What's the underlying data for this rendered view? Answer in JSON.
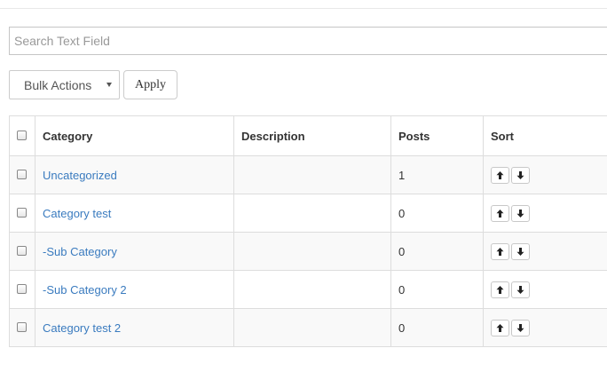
{
  "search": {
    "placeholder": "Search Text Field"
  },
  "bulk_actions": {
    "selected": "Bulk Actions"
  },
  "apply_label": "Apply",
  "table": {
    "headers": {
      "category": "Category",
      "description": "Description",
      "posts": "Posts",
      "sort": "Sort"
    },
    "rows": [
      {
        "category": "Uncategorized",
        "description": "",
        "posts": "1"
      },
      {
        "category": "Category test",
        "description": "",
        "posts": "0"
      },
      {
        "category": "-Sub Category",
        "description": "",
        "posts": "0"
      },
      {
        "category": "-Sub Category 2",
        "description": "",
        "posts": "0"
      },
      {
        "category": "Category test 2",
        "description": "",
        "posts": "0"
      }
    ]
  },
  "icons": {
    "sort_up": "arrow-up-icon",
    "sort_down": "arrow-down-icon"
  },
  "colors": {
    "link": "#3a7bbf",
    "border": "#dddddd",
    "row_alt": "#f9f9f9"
  }
}
